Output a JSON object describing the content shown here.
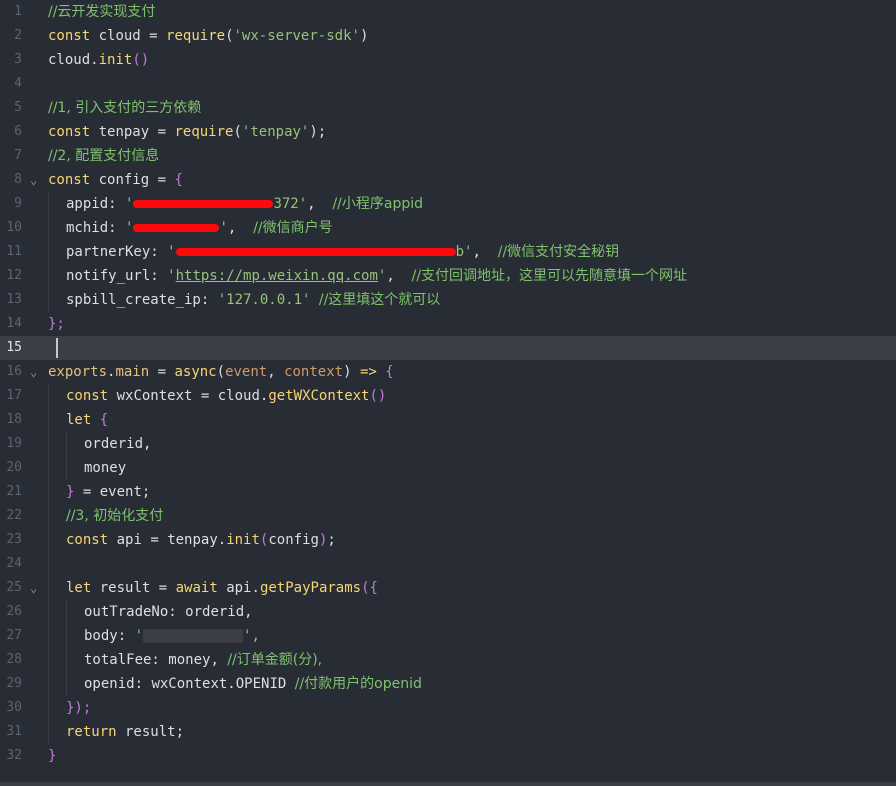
{
  "lines": [
    {
      "n": "1",
      "t": "//云开发实现支付"
    },
    {
      "n": "2",
      "t": "const cloud = require('wx-server-sdk')"
    },
    {
      "n": "3",
      "t": "cloud.init()"
    },
    {
      "n": "4",
      "t": ""
    },
    {
      "n": "5",
      "t": "//1, 引入支付的三方依赖"
    },
    {
      "n": "6",
      "t": "const tenpay = require('tenpay');"
    },
    {
      "n": "7",
      "t": "//2, 配置支付信息"
    },
    {
      "n": "8",
      "t": "const config = {"
    },
    {
      "n": "9",
      "t": "appid: '…372', //小程序appid"
    },
    {
      "n": "10",
      "t": "mchid: '…', //微信商户号"
    },
    {
      "n": "11",
      "t": "partnerKey: '…b', //微信支付安全秘钥"
    },
    {
      "n": "12",
      "t": "notify_url: 'https://mp.weixin.qq.com', //支付回调地址，这里可以先随意填一个网址"
    },
    {
      "n": "13",
      "t": "spbill_create_ip: '127.0.0.1' //这里填这个就可以"
    },
    {
      "n": "14",
      "t": "};"
    },
    {
      "n": "15",
      "t": ""
    },
    {
      "n": "16",
      "t": "exports.main = async(event, context) => {"
    },
    {
      "n": "17",
      "t": "const wxContext = cloud.getWXContext()"
    },
    {
      "n": "18",
      "t": "let {"
    },
    {
      "n": "19",
      "t": "orderid,"
    },
    {
      "n": "20",
      "t": "money"
    },
    {
      "n": "21",
      "t": "} = event;"
    },
    {
      "n": "22",
      "t": "//3, 初始化支付"
    },
    {
      "n": "23",
      "t": "const api = tenpay.init(config);"
    },
    {
      "n": "24",
      "t": ""
    },
    {
      "n": "25",
      "t": "let result = await api.getPayParams({"
    },
    {
      "n": "26",
      "t": "outTradeNo: orderid,"
    },
    {
      "n": "27",
      "t": "body: '…',"
    },
    {
      "n": "28",
      "t": "totalFee: money, //订单金额(分),"
    },
    {
      "n": "29",
      "t": "openid: wxContext.OPENID //付款用户的openid"
    },
    {
      "n": "30",
      "t": "});"
    },
    {
      "n": "31",
      "t": "return result;"
    },
    {
      "n": "32",
      "t": "}"
    }
  ],
  "tokens": {
    "c1": "//云开发实现支付",
    "const": "const",
    "let": "let",
    "await": "await",
    "async": "async",
    "return": "return",
    "require": "require",
    "cloud": "cloud",
    "eq": " = ",
    "sdk": "'wx-server-sdk'",
    "init": "init",
    "dot": ".",
    "paren_open": "(",
    "paren_close": ")",
    "paren_pair": "()",
    "semi": ";",
    "c5": "//1, 引入支付的三方依赖",
    "tenpay": "tenpay",
    "tenpay_str": "'tenpay'",
    "c7": "//2, 配置支付信息",
    "config": "config",
    "brace_open": "{",
    "brace_close": "}",
    "brace_close_semi": "};",
    "appid_key": "appid: ",
    "appid_tail": "372'",
    "comma_sp": ",  ",
    "c9": "//小程序appid",
    "mchid_key": "mchid: ",
    "quote": "'",
    "c10": "//微信商户号",
    "partner_key": "partnerKey: ",
    "partner_tail": "b'",
    "c11": "//微信支付安全秘钥",
    "notify_key": "notify_url: ",
    "notify_url": "https://mp.weixin.qq.com",
    "c12": "//支付回调地址，这里可以先随意填一个网址",
    "ip_key": "spbill_create_ip: ",
    "ip_val": "'127.0.0.1'",
    "c13": "//这里填这个就可以",
    "exports": "exports",
    "main": "main",
    "event": "event",
    "context": "context",
    "comma": ", ",
    "arrow": " => ",
    "wxContext": "wxContext",
    "getWXContext": "getWXContext",
    "orderid": "orderid",
    "orderid_c": "orderid,",
    "money": "money",
    "eq_event": " = event;",
    "c22": "//3, 初始化支付",
    "api": "api",
    "result": "result",
    "getPayParams": "getPayParams",
    "outTradeNo_key": "outTradeNo: ",
    "body_key": "body: ",
    "quote_comma": "',",
    "totalFee_key": "totalFee: ",
    "money_comma": "money, ",
    "c28": "//订单金额(分),",
    "openid_key": "openid: ",
    "openid_val": "wxContext.OPENID ",
    "c29": "//付款用户的openid",
    "close_call": "});",
    "result_semi": " result;"
  }
}
